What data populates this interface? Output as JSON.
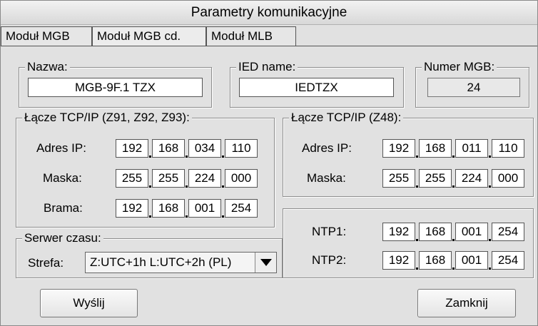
{
  "window": {
    "title": "Parametry komunikacyjne"
  },
  "tabs": [
    {
      "label": "Moduł MGB",
      "active": false
    },
    {
      "label": "Moduł MGB cd.",
      "active": true
    },
    {
      "label": "Moduł MLB",
      "active": false
    }
  ],
  "nazwa": {
    "legend": "Nazwa:",
    "value": "MGB-9F.1 TZX"
  },
  "ied": {
    "legend": "IED name:",
    "value": "IEDTZX"
  },
  "numer": {
    "legend": "Numer MGB:",
    "value": "24"
  },
  "tcp1": {
    "legend": "Łącze TCP/IP (Z91, Z92, Z93):",
    "rows": [
      {
        "label": "Adres IP:",
        "octets": [
          "192",
          "168",
          "034",
          "110"
        ]
      },
      {
        "label": "Maska:",
        "octets": [
          "255",
          "255",
          "224",
          "000"
        ]
      },
      {
        "label": "Brama:",
        "octets": [
          "192",
          "168",
          "001",
          "254"
        ]
      }
    ]
  },
  "tcp2": {
    "legend": "Łącze TCP/IP (Z48):",
    "rows": [
      {
        "label": "Adres IP:",
        "octets": [
          "192",
          "168",
          "011",
          "110"
        ]
      },
      {
        "label": "Maska:",
        "octets": [
          "255",
          "255",
          "224",
          "000"
        ]
      }
    ]
  },
  "serwer": {
    "legend": "Serwer czasu:",
    "strefa_label": "Strefa:",
    "strefa_value": "Z:UTC+1h L:UTC+2h (PL)"
  },
  "ntp": {
    "rows": [
      {
        "label": "NTP1:",
        "octets": [
          "192",
          "168",
          "001",
          "254"
        ]
      },
      {
        "label": "NTP2:",
        "octets": [
          "192",
          "168",
          "001",
          "254"
        ]
      }
    ]
  },
  "buttons": {
    "send": "Wyślij",
    "close": "Zamknij"
  },
  "colors": {
    "window_bg": "#e1e1e1",
    "field_bg": "#ffffff",
    "readonly_bg": "#e8e8e8"
  }
}
